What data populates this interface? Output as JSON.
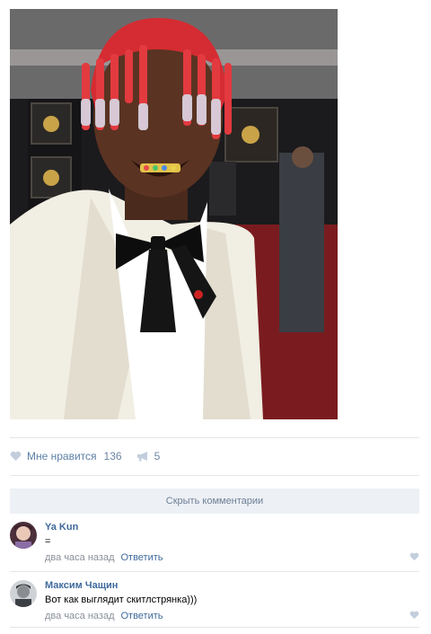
{
  "post": {
    "photo_icon": "portrait-photo",
    "likes_label": "Мне нравится",
    "likes_count": "136",
    "shares_count": "5"
  },
  "comments_toggle": "Скрыть комментарии",
  "comments": [
    {
      "author": "Ya Kun",
      "text": "=",
      "time": "два часа назад",
      "reply": "Ответить"
    },
    {
      "author": "Максим Чащин",
      "text": "Вот как выглядит скитлстрянка)))",
      "time": "два часа назад",
      "reply": "Ответить"
    }
  ],
  "colors": {
    "link": "#3f6a9c",
    "bar": "#edf0f5",
    "icon": "#c3cedd"
  }
}
